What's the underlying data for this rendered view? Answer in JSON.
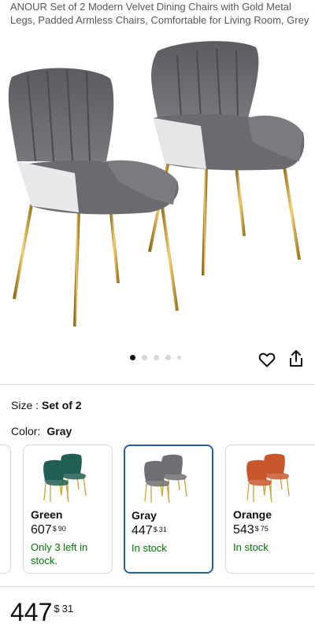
{
  "product": {
    "title": "ANOUR Set of 2 Modern Velvet Dining Chairs with Gold Metal Legs, Padded Armless Chairs, Comfortable for Living Room, Grey"
  },
  "carousel": {
    "count": 5,
    "active_index": 0
  },
  "icons": {
    "wishlist": "heart-icon",
    "share": "share-icon"
  },
  "size": {
    "label": "Size :",
    "value": "Set of 2"
  },
  "color": {
    "label": "Color:",
    "value": "Gray"
  },
  "variants": [
    {
      "name": "Green",
      "whole": "607",
      "symbol": "$",
      "cents": "90",
      "stock": "Only 3 left in stock.",
      "chair_color": "#1f5e52",
      "selected": false
    },
    {
      "name": "Gray",
      "whole": "447",
      "symbol": "$",
      "cents": "31",
      "stock": "In stock",
      "chair_color": "#6e6f72",
      "selected": true
    },
    {
      "name": "Orange",
      "whole": "543",
      "symbol": "$",
      "cents": "75",
      "stock": "In stock",
      "chair_color": "#c8572e",
      "selected": false
    }
  ],
  "price": {
    "whole": "447",
    "symbol": "$",
    "cents": "31"
  },
  "colors": {
    "accent": "#2162a1",
    "in_stock": "#007600",
    "gold": "#c9a23a"
  }
}
